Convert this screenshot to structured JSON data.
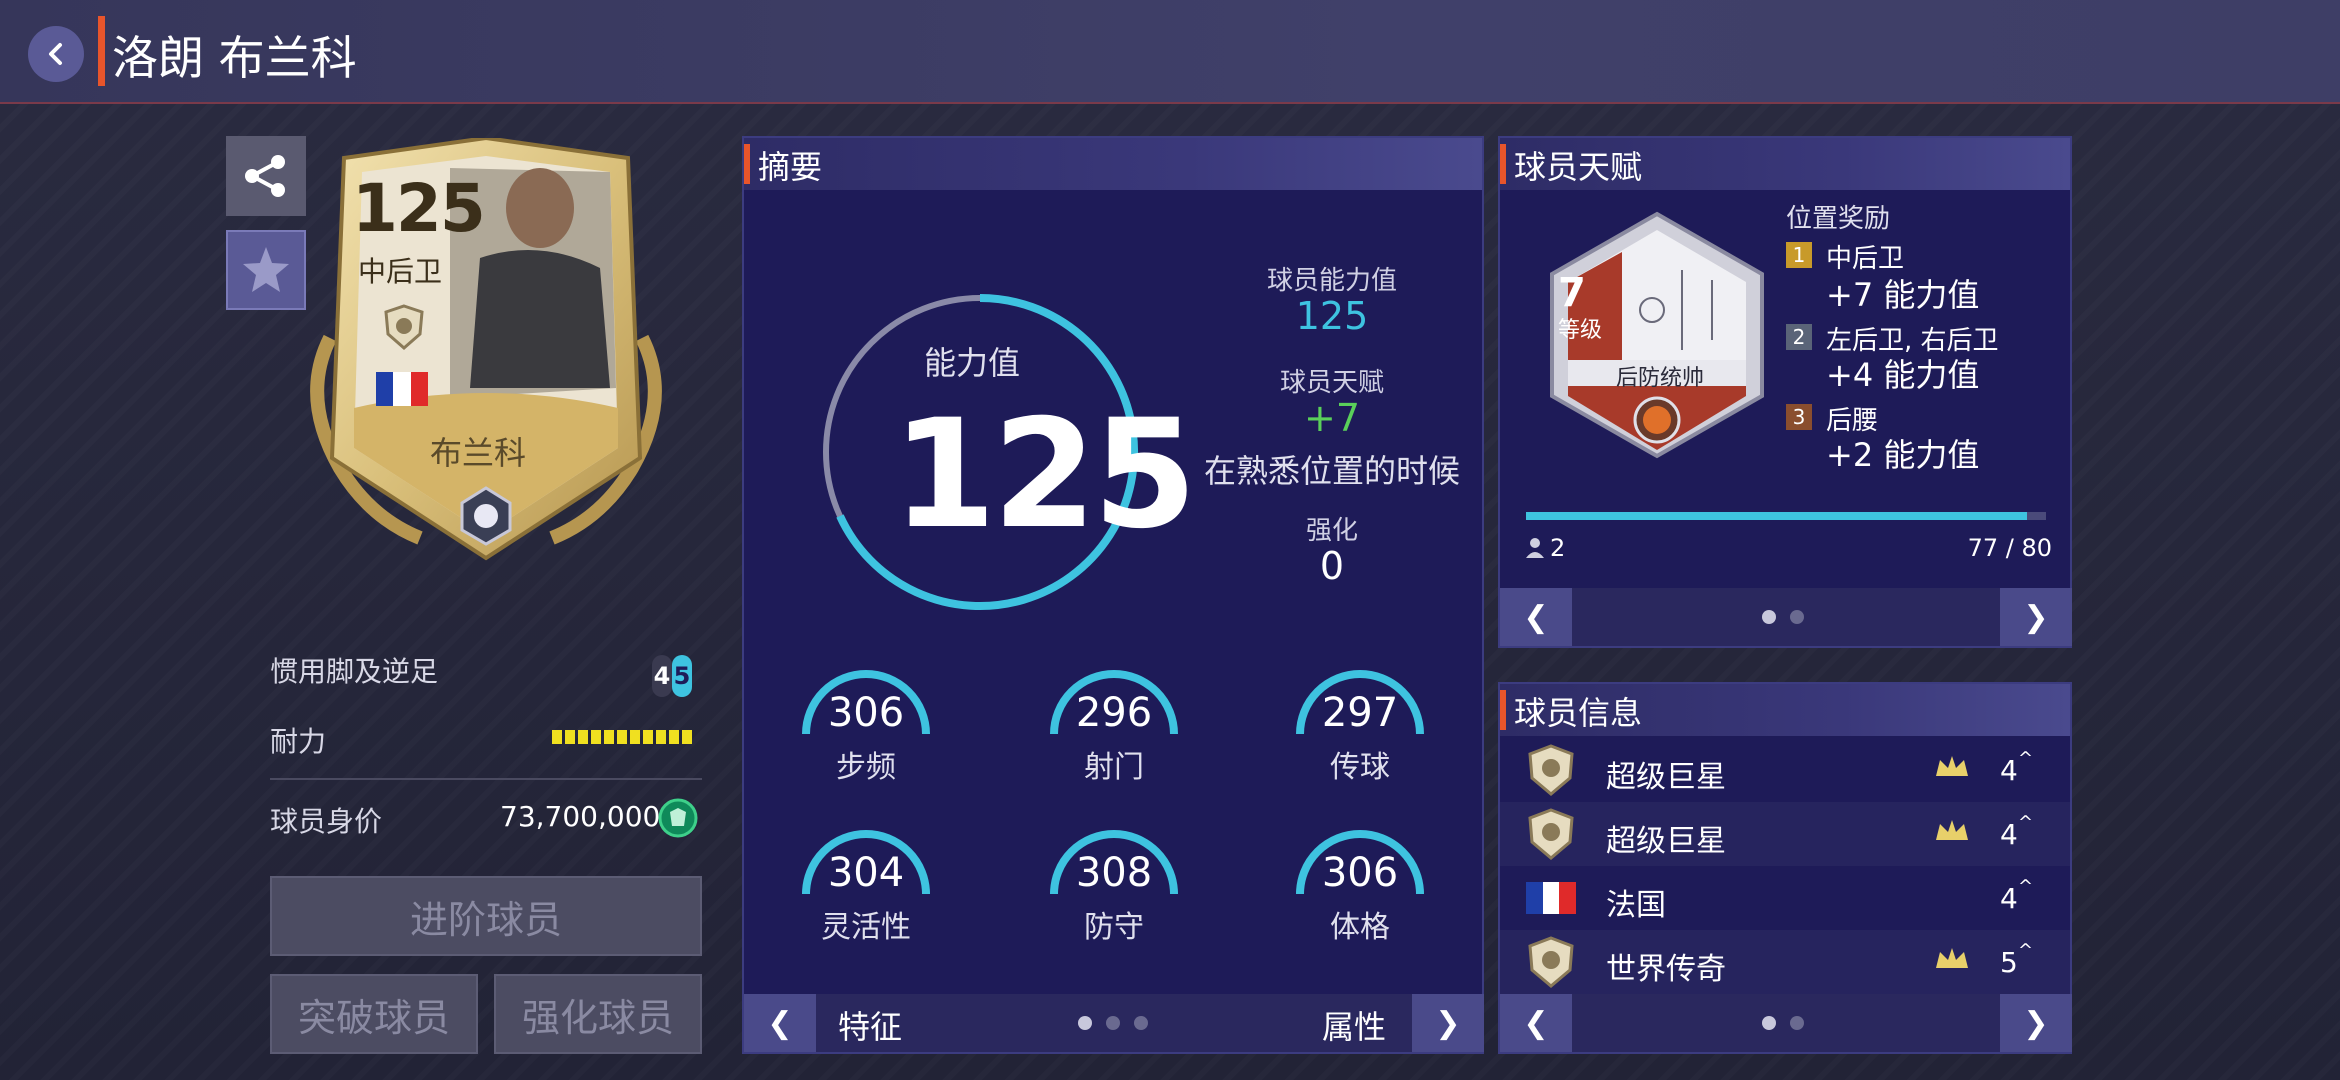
{
  "header": {
    "title": "洛朗 布兰科",
    "back_icon": "back-icon"
  },
  "card": {
    "rating": "125",
    "position": "中后卫",
    "name": "布兰科",
    "flag": "france-flag",
    "colors": {
      "gold": "#d9bf7a",
      "frame": "#b69650"
    }
  },
  "left": {
    "foot_label": "惯用脚及逆足",
    "foot_weak": "4",
    "foot_strong": "5",
    "stamina_label": "耐力",
    "stamina_level": 1.0,
    "price_label": "球员身价",
    "price_value": "73,700,000",
    "buttons": {
      "advance": "进阶球员",
      "breakthrough": "突破球员",
      "enhance": "强化球员"
    }
  },
  "summary": {
    "title": "摘要",
    "ring_label": "能力值",
    "ring_value": "125",
    "ovr_label": "球员能力值",
    "ovr_value": "125",
    "talent_label": "球员天赋",
    "talent_value": "+7",
    "talent_note": "在熟悉位置的时候",
    "enhance_label": "强化",
    "enhance_value": "0",
    "stats": [
      {
        "value": "306",
        "label": "步频"
      },
      {
        "value": "296",
        "label": "射门"
      },
      {
        "value": "297",
        "label": "传球"
      },
      {
        "value": "304",
        "label": "灵活性"
      },
      {
        "value": "308",
        "label": "防守"
      },
      {
        "value": "306",
        "label": "体格"
      }
    ],
    "nav_left_label": "特征",
    "nav_right_label": "属性",
    "page_count": 3,
    "page_index": 1,
    "accent": "#3ec3e0"
  },
  "talent": {
    "title": "球员天赋",
    "level": "7",
    "level_label": "等级",
    "badge_name": "后防统帅",
    "bonus_title": "位置奖励",
    "bonuses": [
      {
        "rank": "1",
        "position": "中后卫",
        "value": "+7 能力值",
        "color": "#c89a2a"
      },
      {
        "rank": "2",
        "position": "左后卫, 右后卫",
        "value": "+4 能力值",
        "color": "#5a6478"
      },
      {
        "rank": "3",
        "position": "后腰",
        "value": "+2 能力值",
        "color": "#8a4e2e"
      }
    ],
    "owners": "2",
    "progress_text": "77 / 80",
    "progress": 0.9625,
    "page_count": 2,
    "page_index": 1
  },
  "info": {
    "title": "球员信息",
    "rows": [
      {
        "name": "超级巨星",
        "value": "4",
        "badge": "icon-badge",
        "crown": true
      },
      {
        "name": "超级巨星",
        "value": "4",
        "badge": "icon-badge",
        "crown": true
      },
      {
        "name": "法国",
        "value": "4",
        "badge": "france-flag",
        "crown": false
      },
      {
        "name": "世界传奇",
        "value": "5",
        "badge": "icon-badge",
        "crown": true
      }
    ],
    "page_count": 2,
    "page_index": 1
  }
}
